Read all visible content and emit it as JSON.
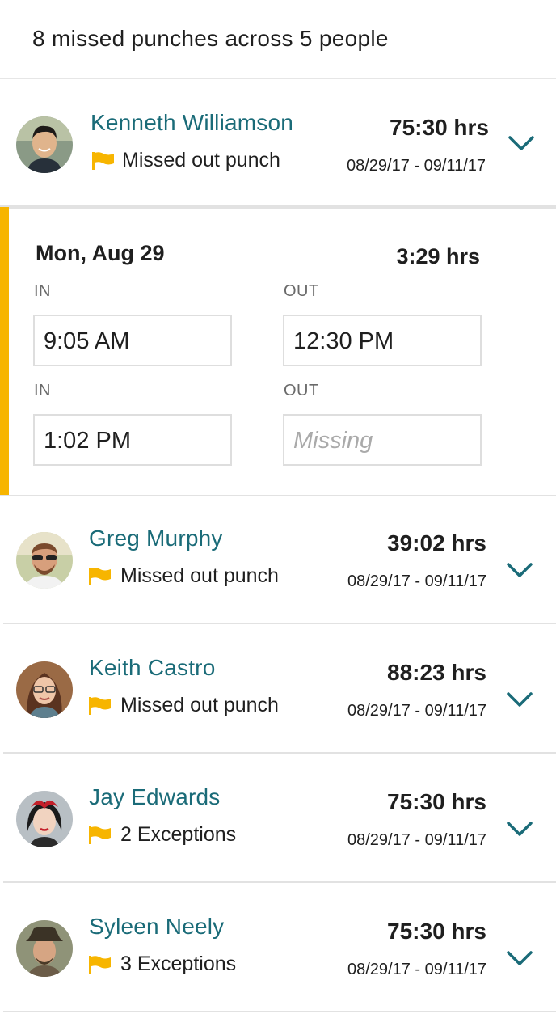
{
  "header": {
    "title": "8 missed punches across 5 people"
  },
  "colors": {
    "accent": "#f7b500",
    "name": "#1a6b78",
    "chevron": "#1a6b78"
  },
  "employees": [
    {
      "name": "Kenneth Williamson",
      "status": "Missed out punch",
      "hours": "75:30 hrs",
      "dates": "08/29/17 - 09/11/17",
      "expanded": true,
      "icon": "flag-icon"
    },
    {
      "name": "Greg Murphy",
      "status": "Missed out punch",
      "hours": "39:02 hrs",
      "dates": "08/29/17 - 09/11/17",
      "icon": "flag-icon"
    },
    {
      "name": "Keith Castro",
      "status": "Missed out punch",
      "hours": "88:23 hrs",
      "dates": "08/29/17 - 09/11/17",
      "icon": "flag-icon"
    },
    {
      "name": "Jay Edwards",
      "status": "2 Exceptions",
      "hours": "75:30 hrs",
      "dates": "08/29/17 - 09/11/17",
      "icon": "flag-icon"
    },
    {
      "name": "Syleen Neely",
      "status": "3 Exceptions",
      "hours": "75:30 hrs",
      "dates": "08/29/17 - 09/11/17",
      "icon": "flag-icon"
    }
  ],
  "detail": {
    "day": "Mon, Aug 29",
    "hours": "3:29 hrs",
    "in_label": "IN",
    "out_label": "OUT",
    "punches": [
      {
        "in": "9:05 AM",
        "out": "12:30 PM"
      },
      {
        "in": "1:02 PM",
        "out_placeholder": "Missing"
      }
    ]
  }
}
